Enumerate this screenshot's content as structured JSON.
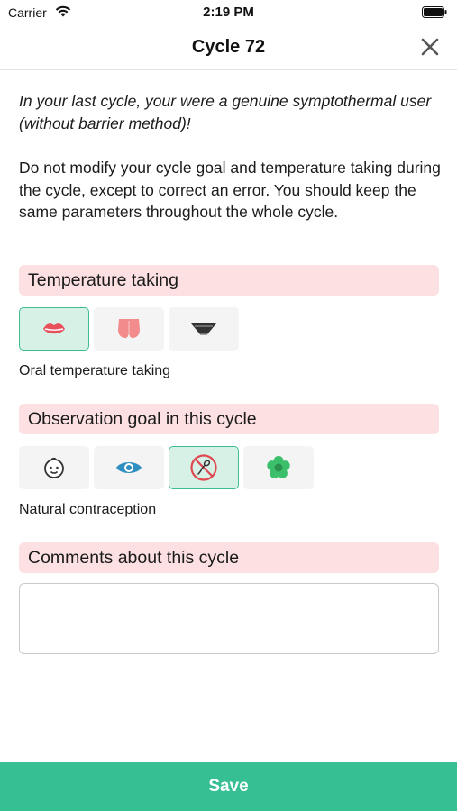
{
  "status_bar": {
    "carrier": "Carrier",
    "time": "2:19 PM"
  },
  "nav": {
    "title": "Cycle 72"
  },
  "intro_text": "In your last cycle, your were a genuine symptothermal user (without barrier method)!",
  "notice_text": "Do not modify your cycle goal and temperature taking during the cycle, except to correct an error. You should keep the same parameters throughout the whole cycle.",
  "temperature": {
    "header": "Temperature taking",
    "options": [
      {
        "icon": "lips-icon",
        "selected": true
      },
      {
        "icon": "buttocks-icon",
        "selected": false
      },
      {
        "icon": "underwear-icon",
        "selected": false
      }
    ],
    "selected_label": "Oral temperature taking"
  },
  "goal": {
    "header": "Observation goal in this cycle",
    "options": [
      {
        "icon": "baby-face-icon",
        "selected": false
      },
      {
        "icon": "eye-icon",
        "selected": false
      },
      {
        "icon": "no-sperm-icon",
        "selected": true
      },
      {
        "icon": "flower-icon",
        "selected": false
      }
    ],
    "selected_label": "Natural contraception"
  },
  "comments": {
    "header": "Comments about this cycle",
    "value": ""
  },
  "save_label": "Save",
  "colors": {
    "accent": "#36bf93",
    "section_bg": "#fde0e1",
    "selected_bg": "#d8f1e7",
    "selected_border": "#3cbf8d"
  }
}
